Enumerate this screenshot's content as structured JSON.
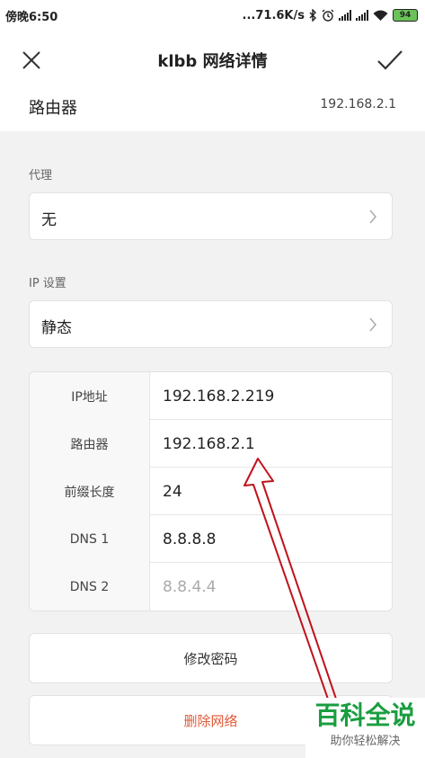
{
  "status_bar": {
    "time": "傍晚6:50",
    "speed": "...71.6K/s",
    "battery": "94",
    "icons": [
      "bluetooth-icon",
      "alarm-icon",
      "signal-icon",
      "signal-icon",
      "wifi-icon",
      "battery-icon"
    ]
  },
  "header": {
    "title": "klbb 网络详情",
    "close_icon": "close-icon",
    "confirm_icon": "check-icon"
  },
  "router": {
    "label": "路由器",
    "value": "192.168.2.1"
  },
  "proxy": {
    "section_label": "代理",
    "value": "无"
  },
  "ip_settings": {
    "section_label": "IP 设置",
    "value": "静态"
  },
  "ip_table": [
    {
      "key": "IP地址",
      "value": "192.168.2.219",
      "muted": false
    },
    {
      "key": "路由器",
      "value": "192.168.2.1",
      "muted": false
    },
    {
      "key": "前缀长度",
      "value": "24",
      "muted": false
    },
    {
      "key": "DNS 1",
      "value": "8.8.8.8",
      "muted": false
    },
    {
      "key": "DNS 2",
      "value": "8.8.4.4",
      "muted": true
    }
  ],
  "buttons": {
    "change_password": "修改密码",
    "delete_network": "删除网络"
  },
  "watermark": {
    "logo": "百科全说",
    "sub": "助你轻松解决"
  },
  "colors": {
    "accent_delete": "#e05a3a",
    "annotation_arrow": "#c0121b",
    "watermark_green": "#1a9e3f",
    "battery_green": "#6ac259"
  }
}
